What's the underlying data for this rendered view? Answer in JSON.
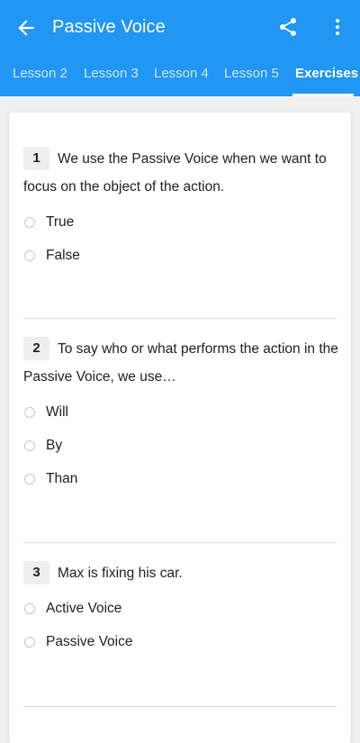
{
  "app_bar": {
    "title": "Passive Voice",
    "back_icon": "arrow-left-icon",
    "share_icon": "share-icon",
    "more_icon": "more-vertical-icon",
    "color": "#2196f3"
  },
  "tabs": [
    {
      "label": "Lesson 2",
      "active": false
    },
    {
      "label": "Lesson 3",
      "active": false
    },
    {
      "label": "Lesson 4",
      "active": false
    },
    {
      "label": "Lesson 5",
      "active": false
    },
    {
      "label": "Exercises",
      "active": true
    }
  ],
  "questions": [
    {
      "number": "1",
      "text": "We use the Passive Voice when we want to focus on the object of the action.",
      "options": [
        "True",
        "False"
      ]
    },
    {
      "number": "2",
      "text": "To say who or what performs the action in the Passive Voice, we use…",
      "options": [
        "Will",
        "By",
        "Than"
      ]
    },
    {
      "number": "3",
      "text": "Max is fixing his car.",
      "options": [
        "Active Voice",
        "Passive Voice"
      ]
    }
  ]
}
